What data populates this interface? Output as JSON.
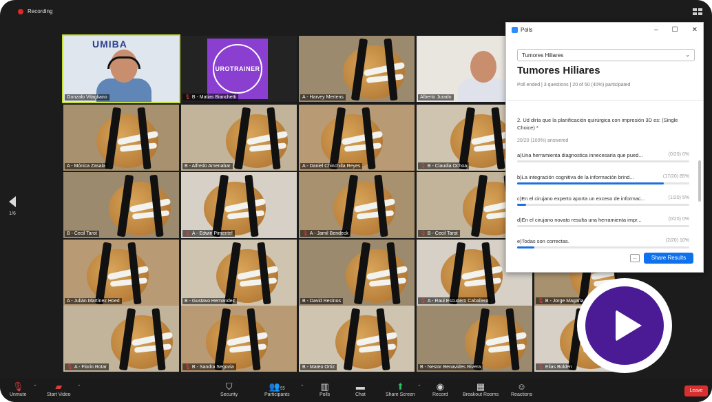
{
  "recording": {
    "label": "Recording"
  },
  "pager": {
    "page": "1/6"
  },
  "participants": [
    {
      "name": "Gonzalo Vitagliano",
      "muted": false
    },
    {
      "name": "B - Matias Bianchetti",
      "muted": true
    },
    {
      "name": "A - Harvey Mertens",
      "muted": false
    },
    {
      "name": "Alberto Jurado",
      "muted": false
    },
    {
      "name": "A - Mónica Zasala",
      "muted": false
    },
    {
      "name": "B - Alfredo Amenabar",
      "muted": false
    },
    {
      "name": "A - Daniel Chinchilla Reyes",
      "muted": false
    },
    {
      "name": "B - Claudia Ochoa",
      "muted": true
    },
    {
      "name": "B - Cecil Tarot",
      "muted": false
    },
    {
      "name": "A - Edwin Pimentel",
      "muted": true
    },
    {
      "name": "A - Jamil Bendeck",
      "muted": true
    },
    {
      "name": "B - Cecil Tarot",
      "muted": true
    },
    {
      "name": "A - Julián Martínez Hoed",
      "muted": false
    },
    {
      "name": "B - Gustavo Hernandez",
      "muted": false
    },
    {
      "name": "B - David Recinos",
      "muted": false
    },
    {
      "name": "A - Raul Escudero Caballero",
      "muted": true
    },
    {
      "name": "B - Jorge Magaña",
      "muted": true
    },
    {
      "name": "A - Florin Rotar",
      "muted": true
    },
    {
      "name": "B - Sandra Segovia",
      "muted": true
    },
    {
      "name": "B - Mateo Ortiz",
      "muted": false
    },
    {
      "name": "B - Nestor Benavides Rivera",
      "muted": false
    },
    {
      "name": "Elias Bolden",
      "muted": true
    }
  ],
  "tile_text": {
    "umiba": "UMIBA",
    "urotrainer": "UROTRAINER"
  },
  "polls": {
    "window_title": "Polls",
    "controls": [
      "–",
      "☐",
      "✕"
    ],
    "selected_poll": "Tumores Hiliares",
    "heading": "Tumores Hiliares",
    "meta": "Poll ended | 3 questions | 20 of 50 (40%) participated",
    "question": "2. Ud diría que la planificación quirúrgica con impresión 3D es: (Single Choice) *",
    "answered": "20/20 (100%) answered",
    "options": [
      {
        "label": "a)Una herramienta diagnostica innecesaria que pued...",
        "stat": "(0/20) 0%",
        "pct": 0
      },
      {
        "label": "b)La integración cognitiva de la información brind...",
        "stat": "(17/20) 85%",
        "pct": 85
      },
      {
        "label": "c)En el cirujano experto aporta un exceso de informac...",
        "stat": "(1/20) 5%",
        "pct": 5
      },
      {
        "label": "d)En el cirujano novato resulta una herramienta impr...",
        "stat": "(0/20) 0%",
        "pct": 0
      },
      {
        "label": "e)Todas son correctas.",
        "stat": "(2/20) 10%",
        "pct": 10
      }
    ],
    "more_label": "...",
    "share_label": "Share Results"
  },
  "toolbar": {
    "mute": "Unmute",
    "video": "Start Video",
    "security": "Security",
    "participants": "Participants",
    "participants_count": "55",
    "polls": "Polls",
    "chat": "Chat",
    "share": "Share Screen",
    "record": "Record",
    "breakout": "Breakout Rooms",
    "reactions": "Reactions",
    "leave": "Leave"
  },
  "colors": {
    "accent": "#0e72ed",
    "active_speaker": "#c7df3b",
    "play_button": "#4b1b96",
    "leave": "#d92f2f"
  }
}
